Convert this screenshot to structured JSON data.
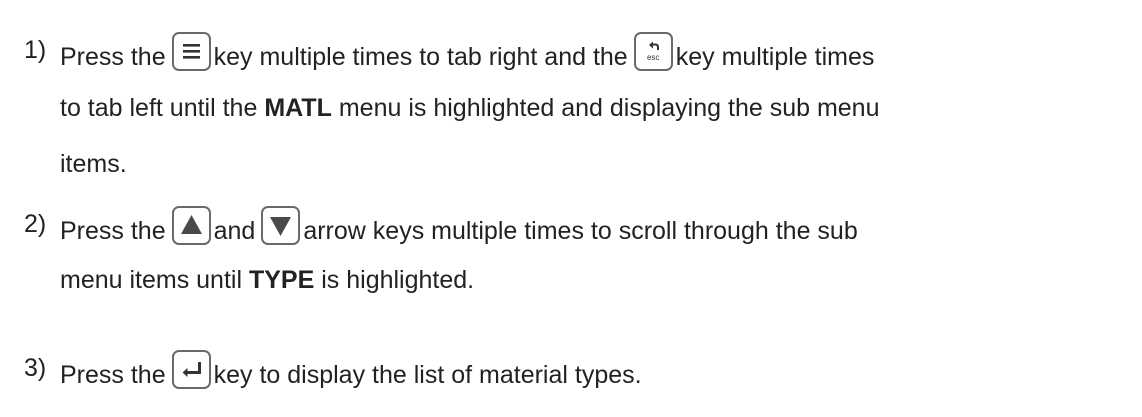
{
  "steps": [
    {
      "number": "1)",
      "lines": [
        {
          "a": "Press the",
          "b": "key multiple times to tab right and the",
          "c": "key multiple times"
        },
        {
          "a": "to tab left until the",
          "bold": "MATL",
          "b": "menu is highlighted and displaying the sub menu"
        },
        {
          "a": "items."
        }
      ],
      "keys": [
        {
          "name": "menu-key-icon",
          "icon": "menu-icon"
        },
        {
          "name": "esc-key-icon",
          "icon": "back-arrow-icon",
          "label": "esc"
        }
      ]
    },
    {
      "number": "2)",
      "lines": [
        {
          "a": "Press the",
          "b": "and",
          "c": "arrow keys multiple times to scroll through the sub"
        },
        {
          "a": "menu items until",
          "bold": "TYPE",
          "b": "is highlighted."
        }
      ],
      "keys": [
        {
          "name": "up-arrow-key-icon",
          "icon": "triangle-up-icon"
        },
        {
          "name": "down-arrow-key-icon",
          "icon": "triangle-down-icon"
        }
      ]
    },
    {
      "number": "3)",
      "lines": [
        {
          "a": "Press the",
          "b": "key to display the list of material types."
        }
      ],
      "keys": [
        {
          "name": "enter-key-icon",
          "icon": "enter-icon"
        }
      ]
    }
  ]
}
